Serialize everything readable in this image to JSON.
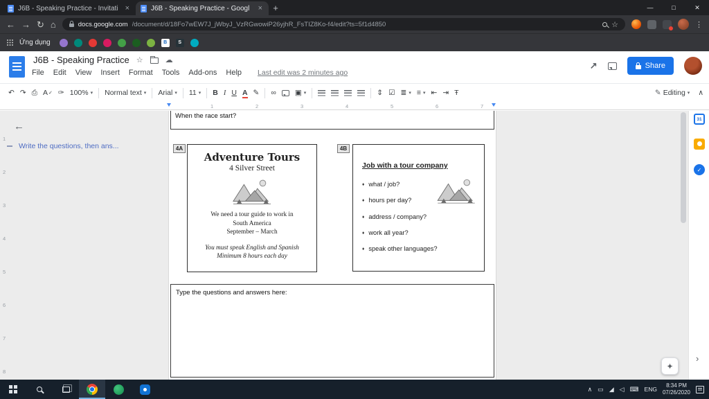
{
  "colors": {
    "accent_blue": "#1a73e8",
    "chrome_dark": "#202124",
    "chrome_toolbar": "#35363a",
    "docs_logo_blue": "#2b7de9",
    "share_button": "#1a73e8",
    "calendar_blue": "#1967d2",
    "keep_yellow": "#f9ab00",
    "tasks_blue": "#1a73e8",
    "taskbar_dark": "#16202b",
    "outline_item_blue": "#4e6cc3"
  },
  "icons": {
    "tab_close": "×",
    "new_tab": "+",
    "minimize": "—",
    "maximize": "□",
    "close": "✕",
    "back": "←",
    "forward": "→",
    "reload": "↻",
    "home": "⌂",
    "star": "☆",
    "menu": "⋮",
    "cloud": "☁",
    "activity": "↗",
    "check": "✓",
    "undo": "↶",
    "redo": "↷",
    "print": "⎙",
    "spellcheck": "A",
    "paint": "✑",
    "caret": "▾",
    "bold": "B",
    "italic": "I",
    "underline": "U",
    "text_color": "A",
    "highlight": "✎",
    "link": "∞",
    "image": "▣",
    "line_spacing": "⇕",
    "checklist": "☑",
    "numbered_list": "≣",
    "bullet_list": "≡",
    "indent_dec": "⇤",
    "indent_inc": "⇥",
    "clear_format": "Ŧ",
    "pencil": "✎",
    "collapse": "∧",
    "chevron_right": "›",
    "back_arrow": "←",
    "chevron_up": "∧",
    "display": "▭",
    "network": "◢",
    "volume": "◁",
    "keyboard": "⌨",
    "diamond": "♦",
    "explore": "✦"
  },
  "browser": {
    "tabs": [
      {
        "title": "J6B - Speaking Practice - Invitati"
      },
      {
        "title": "J6B - Speaking Practice - Googl"
      }
    ],
    "url_domain": "docs.google.com",
    "url_path": "/document/d/18Fo7wEW7J_jWbyJ_VzRGwowiP26yjhR_FsTIZ8Ko-f4/edit?ts=5f1d4850",
    "bookmarks_label": "Ứng dụng",
    "favicon_letters": [
      "",
      "",
      "",
      "",
      "",
      "",
      "",
      "B",
      "S",
      ""
    ]
  },
  "docs": {
    "title": "J6B - Speaking Practice",
    "menus": [
      "File",
      "Edit",
      "View",
      "Insert",
      "Format",
      "Tools",
      "Add-ons",
      "Help"
    ],
    "last_edit": "Last edit was 2 minutes ago",
    "share_label": "Share",
    "toolbar": {
      "zoom": "100%",
      "style": "Normal text",
      "font": "Arial",
      "font_size": "11",
      "mode": "Editing"
    }
  },
  "outline": {
    "item": "Write the questions, then ans..."
  },
  "ruler": {
    "h": [
      "1",
      "2",
      "3",
      "4",
      "5",
      "6",
      "7"
    ],
    "v": [
      "1",
      "2",
      "3",
      "4",
      "5",
      "6",
      "7",
      "8"
    ]
  },
  "document": {
    "top_box_text": "When the race start?",
    "card_a": {
      "label": "4A",
      "title": "Adventure Tours",
      "subtitle": "4 Silver Street",
      "line1": "We need a tour guide to work in",
      "line2": "South America",
      "line3": "September – March",
      "note1": "You must speak English and Spanish",
      "note2": "Minimum 8 hours each day"
    },
    "card_b": {
      "label": "4B",
      "title": "Job with a tour company",
      "bullets": [
        "what / job?",
        "hours per day?",
        "address / company?",
        "work all year?",
        "speak other languages?"
      ]
    },
    "answer_box_text": "Type the questions and answers here:"
  },
  "sidepanel": {
    "calendar_label": "31"
  },
  "taskbar": {
    "language": "ENG",
    "time": "8:34 PM",
    "date": "07/26/2020"
  }
}
